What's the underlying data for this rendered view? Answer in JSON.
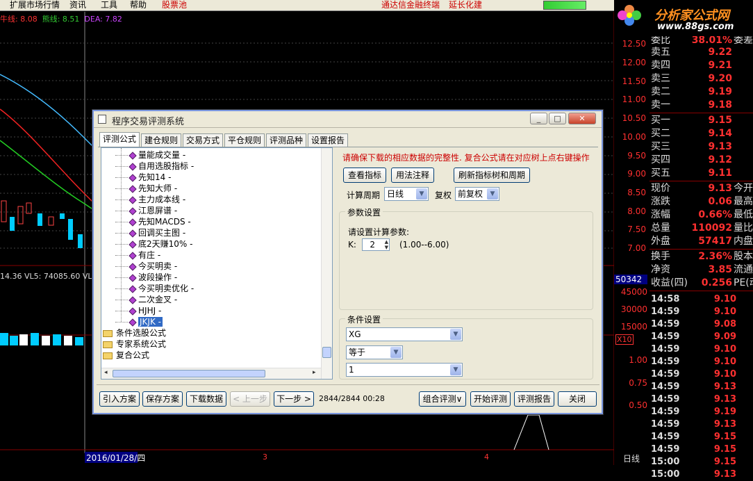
{
  "menubar": {
    "items": [
      "扩展市场行情",
      "资讯",
      "工具",
      "帮助",
      "股票池",
      "通达信金融终端",
      "延长化建"
    ]
  },
  "logo": {
    "title": "分析家公式网",
    "url": "www.88gs.com"
  },
  "chart": {
    "indicator": {
      "a": "牛线: 8.08",
      "b": "熊线: 8.51",
      "c": "DEA: 7.82"
    },
    "volume_line": "14.36  VL5: 74085.60  VL",
    "price_ticks": [
      "12.50",
      "12.00",
      "11.50",
      "11.00",
      "10.50",
      "10.00",
      "9.50",
      "9.00",
      "8.50",
      "8.00",
      "7.50",
      "7.00"
    ],
    "vol_ticks": [
      "50342",
      "45000",
      "30000",
      "15000",
      "X10"
    ],
    "ind_ticks": [
      "1.00",
      "0.75",
      "0.50"
    ],
    "date_label": "2016/01/28/四",
    "x_ticks": [
      "3",
      "4"
    ],
    "period": "日线"
  },
  "quote": {
    "header_partial": {
      "label": "委比",
      "value": "38.01%",
      "right": "委差"
    },
    "sells": [
      {
        "label": "卖五",
        "value": "9.22"
      },
      {
        "label": "卖四",
        "value": "9.21"
      },
      {
        "label": "卖三",
        "value": "9.20"
      },
      {
        "label": "卖二",
        "value": "9.19"
      },
      {
        "label": "卖一",
        "value": "9.18"
      }
    ],
    "buys": [
      {
        "label": "买一",
        "value": "9.15"
      },
      {
        "label": "买二",
        "value": "9.14"
      },
      {
        "label": "买三",
        "value": "9.13"
      },
      {
        "label": "买四",
        "value": "9.12"
      },
      {
        "label": "买五",
        "value": "9.11"
      }
    ],
    "stats": [
      {
        "label": "现价",
        "value": "9.13",
        "right": "今开"
      },
      {
        "label": "涨跌",
        "value": "0.06",
        "right": "最高"
      },
      {
        "label": "涨幅",
        "value": "0.66%",
        "right": "最低"
      },
      {
        "label": "总量",
        "value": "110092",
        "right": "量比"
      },
      {
        "label": "外盘",
        "value": "57417",
        "right": "内盘"
      }
    ],
    "stats2": [
      {
        "label": "换手",
        "value": "2.36%",
        "right": "股本"
      },
      {
        "label": "净资",
        "value": "3.85",
        "right": "流通"
      },
      {
        "label": "收益(四)",
        "value": "0.256",
        "right": "PE(动"
      }
    ],
    "ticks": [
      {
        "time": "14:58",
        "price": "9.10"
      },
      {
        "time": "14:59",
        "price": "9.10"
      },
      {
        "time": "14:59",
        "price": "9.08"
      },
      {
        "time": "14:59",
        "price": "9.09"
      },
      {
        "time": "14:59",
        "price": "9.10"
      },
      {
        "time": "14:59",
        "price": "9.10"
      },
      {
        "time": "14:59",
        "price": "9.10"
      },
      {
        "time": "14:59",
        "price": "9.13"
      },
      {
        "time": "14:59",
        "price": "9.13"
      },
      {
        "time": "14:59",
        "price": "9.19"
      },
      {
        "time": "14:59",
        "price": "9.13"
      },
      {
        "time": "14:59",
        "price": "9.15"
      },
      {
        "time": "14:59",
        "price": "9.15"
      },
      {
        "time": "15:00",
        "price": "9.15"
      },
      {
        "time": "15:00",
        "price": "9.13"
      }
    ]
  },
  "dialog": {
    "title": "程序交易评测系统",
    "tabs": [
      "评测公式",
      "建仓规则",
      "交易方式",
      "平仓规则",
      "评测品种",
      "设置报告"
    ],
    "tree_items": [
      "量能成交量 -",
      "自用选股指标 -",
      "先知14 -",
      "先知大师 -",
      "主力成本线 -",
      "江恩屏谱 -",
      "先知MACDS -",
      "回调买主图 -",
      "底2天赚10% -",
      "有庄 -",
      "今买明卖 -",
      "波段操作 -",
      "今买明卖优化 -",
      "二次金叉 -",
      "HJHJ -",
      "JKJK -"
    ],
    "folders": [
      "条件选股公式",
      "专家系统公式",
      "复合公式"
    ],
    "notice": "请确保下载的相应数据的完整性. 复合公式请在对应树上点右键操作",
    "buttons": {
      "view_indicator": "查看指标",
      "usage_notes": "用法注释",
      "refresh": "刷新指标树和周期"
    },
    "period_label": "计算周期",
    "period_value": "日线",
    "adjust_label": "复权",
    "adjust_value": "前复权",
    "params_group": "参数设置",
    "params_hint": "请设置计算参数:",
    "param_name": "K:",
    "param_value": "2",
    "param_range": "(1.00--6.00)",
    "cond_group": "条件设置",
    "cond_var": "XG",
    "cond_op": "等于",
    "cond_value": "1",
    "bottom": {
      "import": "引入方案",
      "save": "保存方案",
      "download": "下载数据",
      "prev": "< 上一步",
      "next": "下一步 >",
      "progress": "2844/2844 00:28",
      "combo": "组合评测∨",
      "start": "开始评测",
      "report": "评测报告",
      "close": "关闭"
    }
  }
}
